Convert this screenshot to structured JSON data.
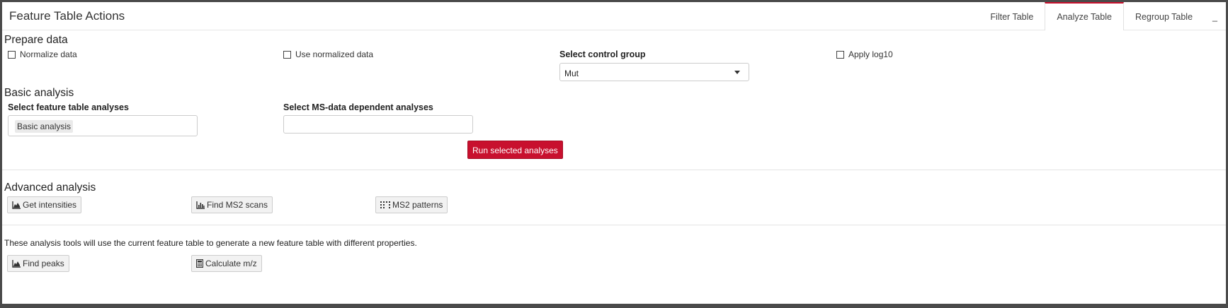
{
  "header": {
    "title": "Feature Table Actions",
    "tabs": [
      {
        "label": "Filter Table"
      },
      {
        "label": "Analyze Table"
      },
      {
        "label": "Regroup Table"
      },
      {
        "label": "_"
      }
    ],
    "accent_color": "#c8102e"
  },
  "prepare": {
    "title": "Prepare data",
    "normalize_label": "Normalize data",
    "use_normalized_label": "Use normalized data",
    "control_group_label": "Select control group",
    "control_group_value": "Mut",
    "apply_log_label": "Apply log10"
  },
  "basic": {
    "title": "Basic analysis",
    "feature_table_label": "Select feature table analyses",
    "feature_table_selected": "Basic analysis",
    "ms_data_label": "Select MS-data dependent analyses",
    "run_button": "Run selected analyses"
  },
  "advanced": {
    "title": "Advanced analysis",
    "get_intensities": "Get intensities",
    "find_ms2": "Find MS2 scans",
    "ms2_patterns": "MS2 patterns"
  },
  "tools": {
    "description": "These analysis tools will use the current feature table to generate a new feature table with different properties.",
    "find_peaks": "Find peaks",
    "calculate_mz": "Calculate m/z"
  }
}
